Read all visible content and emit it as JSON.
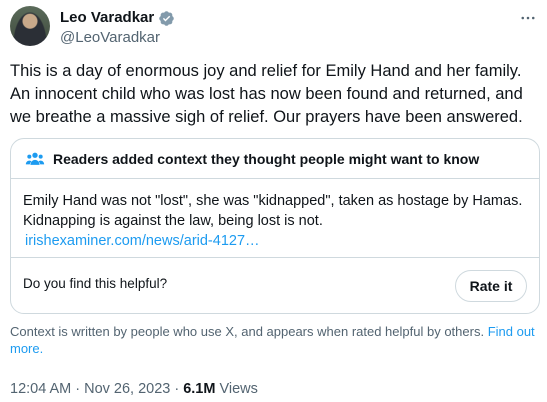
{
  "author": {
    "name": "Leo Varadkar",
    "handle": "@LeoVaradkar",
    "verified_color": "#829aab"
  },
  "tweet": {
    "text": "This is a day of enormous joy and relief for Emily Hand and her family. An innocent child who was lost has now been found and returned, and we breathe a massive sigh of relief.  Our prayers have been answered."
  },
  "community_note": {
    "title": "Readers added context they thought people might want to know",
    "body": "Emily Hand was not \"lost\", she was \"kidnapped\", taken as hostage by Hamas. Kidnapping is against the law, being lost is not.",
    "link": "irishexaminer.com/news/arid-4127…",
    "helpful_prompt": "Do you find this helpful?",
    "rate_label": "Rate it",
    "accent_color": "#1d9bf0"
  },
  "context_info": {
    "text": "Context is written by people who use X, and appears when rated helpful by others.",
    "find_more": "Find out more."
  },
  "meta": {
    "time": "12:04 AM",
    "separator": "·",
    "date": "Nov 26, 2023",
    "views_count": "6.1M",
    "views_label": "Views"
  },
  "icons": {
    "more": "more-horizontal-icon",
    "verified": "verified-badge-icon",
    "note": "people-icon"
  }
}
